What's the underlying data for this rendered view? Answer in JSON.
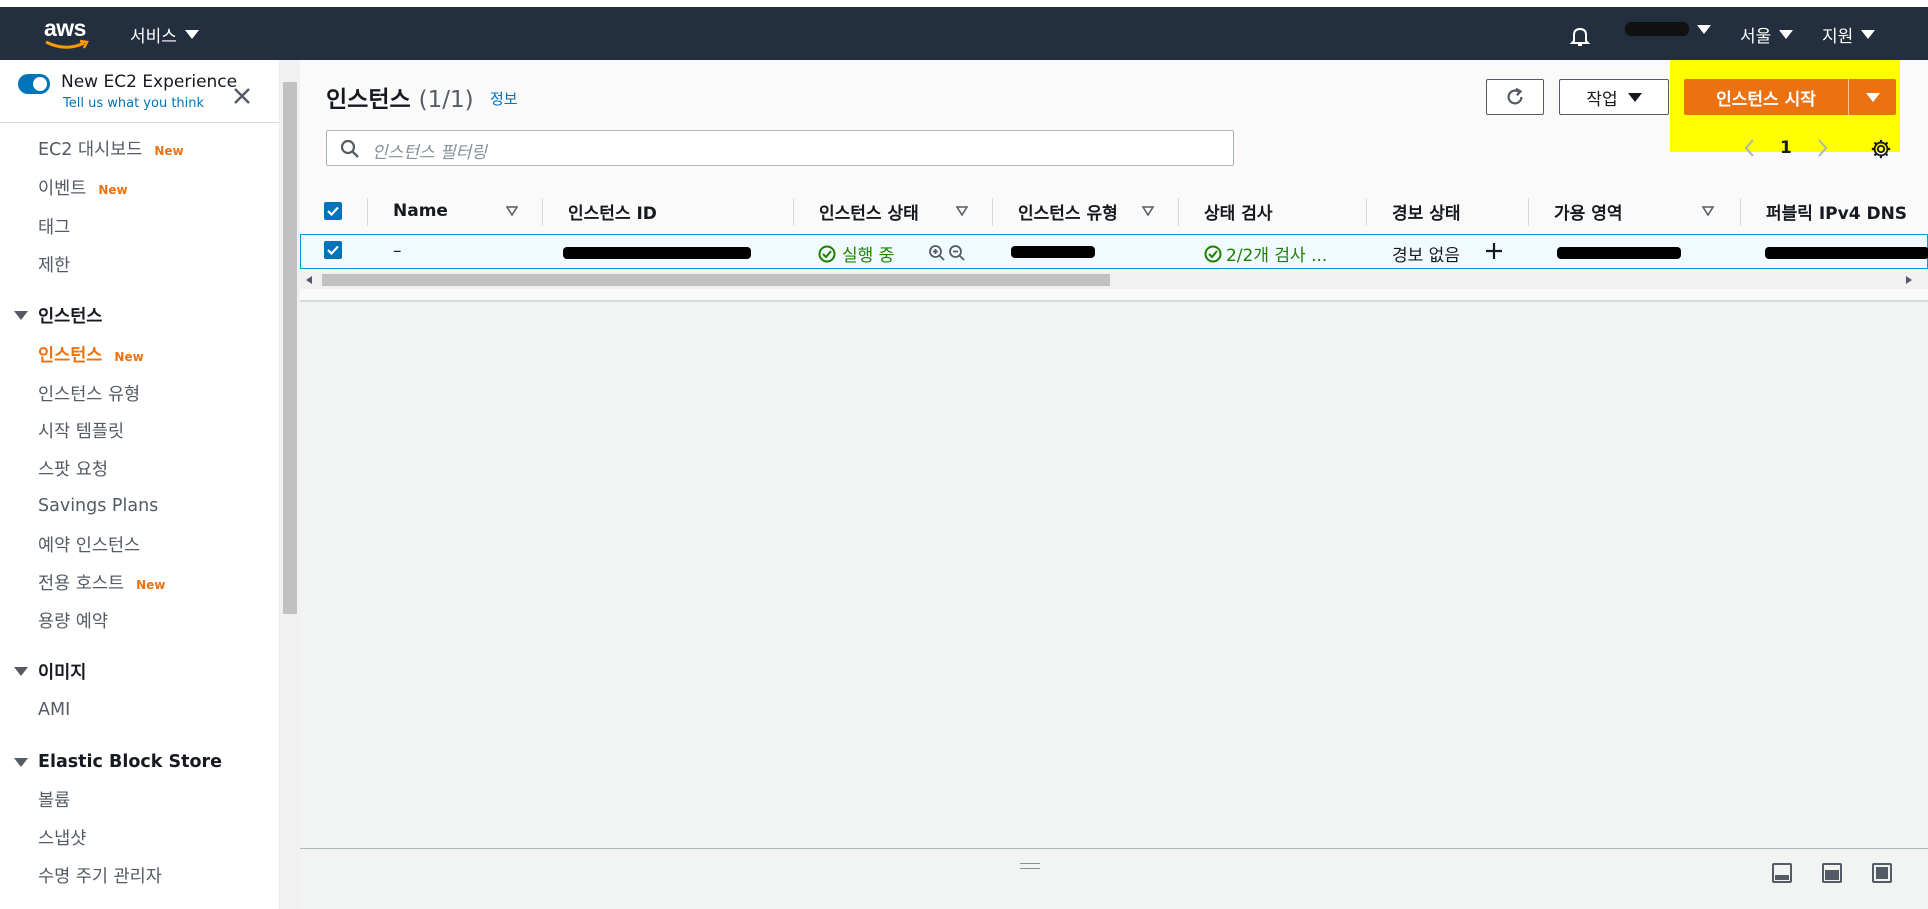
{
  "topbar": {
    "logo_text": "aws",
    "services": "서비스",
    "region": "서울",
    "support": "지원"
  },
  "sidebar": {
    "experience_title": "New EC2 Experience",
    "experience_link": "Tell us what you think",
    "new_badge": "New",
    "items": [
      {
        "label": "EC2 대시보드",
        "new": true
      },
      {
        "label": "이벤트",
        "new": true
      },
      {
        "label": "태그",
        "new": false
      },
      {
        "label": "제한",
        "new": false
      }
    ],
    "sections": [
      {
        "title": "인스턴스",
        "items": [
          {
            "label": "인스턴스",
            "new": true,
            "active": true
          },
          {
            "label": "인스턴스 유형"
          },
          {
            "label": "시작 템플릿"
          },
          {
            "label": "스팟 요청"
          },
          {
            "label": "Savings Plans"
          },
          {
            "label": "예약 인스턴스"
          },
          {
            "label": "전용 호스트",
            "new": true
          },
          {
            "label": "용량 예약"
          }
        ]
      },
      {
        "title": "이미지",
        "items": [
          {
            "label": "AMI"
          }
        ]
      },
      {
        "title": "Elastic Block Store",
        "items": [
          {
            "label": "볼륨"
          },
          {
            "label": "스냅샷"
          },
          {
            "label": "수명 주기 관리자"
          }
        ]
      }
    ]
  },
  "main": {
    "title": "인스턴스",
    "count": "(1/1)",
    "info_link": "정보",
    "actions_button": "작업",
    "launch_button": "인스턴스 시작",
    "search_placeholder": "인스턴스 필터링",
    "page_number": "1",
    "columns": [
      "Name",
      "인스턴스 ID",
      "인스턴스 상태",
      "인스턴스 유형",
      "상태 검사",
      "경보 상태",
      "가용 영역",
      "퍼블릭 IPv4 DNS"
    ],
    "row": {
      "name": "–",
      "state": "실행 중",
      "status_check": "2/2개 검사 ...",
      "alarm": "경보 없음"
    }
  },
  "colors": {
    "topbar": "#232f3e",
    "accent_orange": "#ec7211",
    "link_blue": "#0073bb",
    "success_green": "#1d8102",
    "highlight_yellow": "#ffff00"
  }
}
